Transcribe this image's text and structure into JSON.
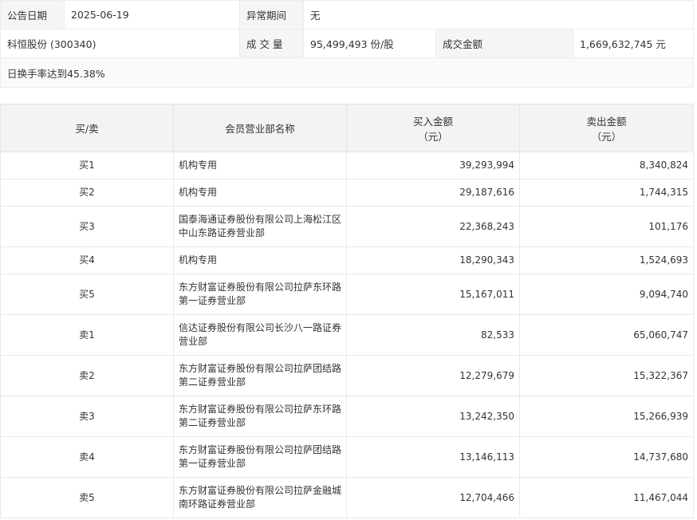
{
  "info": {
    "announce_label": "公告日期",
    "announce_value": "2025-06-19",
    "period_label": "异常期间",
    "period_value": "无",
    "stock": "科恒股份 (300340)",
    "volume_label": "成 交 量",
    "volume_value": "95,499,493 份/股",
    "amount_label": "成交金额",
    "amount_value": "1,669,632,745 元",
    "reason": "日换手率达到45.38%"
  },
  "table": {
    "headers": {
      "side": "买/卖",
      "name": "会员营业部名称",
      "buy_line1": "买入金额",
      "buy_line2": "（元）",
      "sell_line1": "卖出金额",
      "sell_line2": "（元）"
    },
    "rows": [
      {
        "side": "买1",
        "name": "机构专用",
        "buy": "39,293,994",
        "sell": "8,340,824"
      },
      {
        "side": "买2",
        "name": "机构专用",
        "buy": "29,187,616",
        "sell": "1,744,315"
      },
      {
        "side": "买3",
        "name": "国泰海通证券股份有限公司上海松江区中山东路证券营业部",
        "buy": "22,368,243",
        "sell": "101,176"
      },
      {
        "side": "买4",
        "name": "机构专用",
        "buy": "18,290,343",
        "sell": "1,524,693"
      },
      {
        "side": "买5",
        "name": "东方财富证券股份有限公司拉萨东环路第一证券营业部",
        "buy": "15,167,011",
        "sell": "9,094,740"
      },
      {
        "side": "卖1",
        "name": "信达证券股份有限公司长沙八一路证券营业部",
        "buy": "82,533",
        "sell": "65,060,747"
      },
      {
        "side": "卖2",
        "name": "东方财富证券股份有限公司拉萨团结路第二证券营业部",
        "buy": "12,279,679",
        "sell": "15,322,367"
      },
      {
        "side": "卖3",
        "name": "东方财富证券股份有限公司拉萨东环路第二证券营业部",
        "buy": "13,242,350",
        "sell": "15,266,939"
      },
      {
        "side": "卖4",
        "name": "东方财富证券股份有限公司拉萨团结路第一证券营业部",
        "buy": "13,146,113",
        "sell": "14,737,680"
      },
      {
        "side": "卖5",
        "name": "东方财富证券股份有限公司拉萨金融城南环路证券营业部",
        "buy": "12,704,466",
        "sell": "11,467,044"
      }
    ]
  }
}
